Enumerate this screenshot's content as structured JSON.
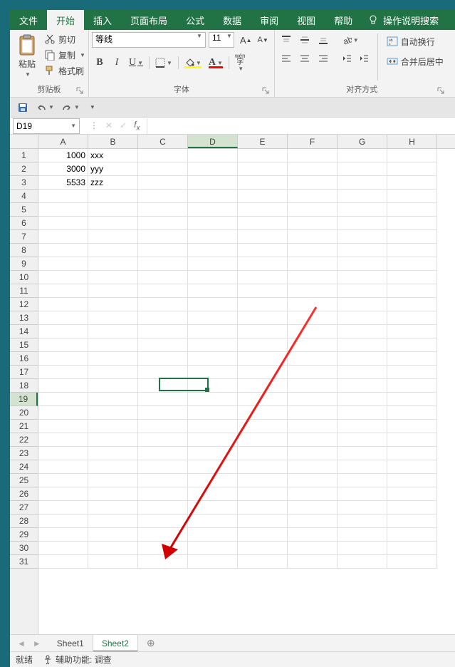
{
  "tabs": {
    "file": "文件",
    "home": "开始",
    "insert": "插入",
    "layout": "页面布局",
    "formulas": "公式",
    "data": "数据",
    "review": "审阅",
    "view": "视图",
    "help": "帮助",
    "tellme": "操作说明搜索"
  },
  "clipboard": {
    "paste": "粘贴",
    "cut": "剪切",
    "copy": "复制",
    "format_painter": "格式刷",
    "group_label": "剪贴板"
  },
  "font": {
    "name": "等线",
    "size": "11",
    "group_label": "字体",
    "pinyin": "wén"
  },
  "alignment": {
    "group_label": "对齐方式",
    "wrap": "自动换行",
    "merge": "合并后居中"
  },
  "name_box": "D19",
  "columns": [
    "A",
    "B",
    "C",
    "D",
    "E",
    "F",
    "G",
    "H"
  ],
  "row_count": 31,
  "selected_col": 3,
  "selected_row": 18,
  "cell_data": [
    {
      "r": 0,
      "c": 0,
      "v": "1000",
      "num": true
    },
    {
      "r": 0,
      "c": 1,
      "v": "xxx"
    },
    {
      "r": 1,
      "c": 0,
      "v": "3000",
      "num": true
    },
    {
      "r": 1,
      "c": 1,
      "v": "yyy"
    },
    {
      "r": 2,
      "c": 0,
      "v": "5533",
      "num": true
    },
    {
      "r": 2,
      "c": 1,
      "v": "zzz"
    }
  ],
  "sheets": {
    "s1": "Sheet1",
    "s2": "Sheet2"
  },
  "status": {
    "ready": "就绪",
    "a11y": "辅助功能: 调查"
  }
}
